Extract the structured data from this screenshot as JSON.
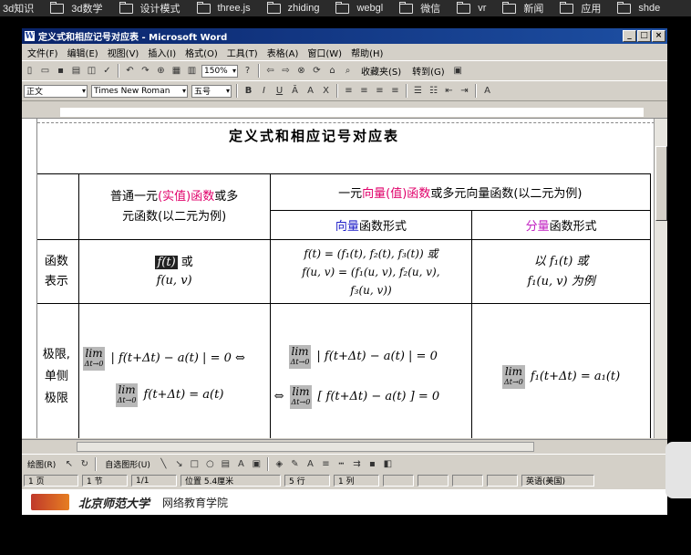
{
  "bookmarks": [
    "3d知识",
    "3d数学",
    "设计模式",
    "three.js",
    "zhiding",
    "webgl",
    "微信",
    "vr",
    "新闻",
    "应用",
    "shde"
  ],
  "window": {
    "title": "定义式和相应记号对应表 - Microsoft Word",
    "icon_letter": "W"
  },
  "menus": [
    "文件(F)",
    "编辑(E)",
    "视图(V)",
    "插入(I)",
    "格式(O)",
    "工具(T)",
    "表格(A)",
    "窗口(W)",
    "帮助(H)"
  ],
  "toolbar": {
    "zoom": "150%",
    "favorites": "收藏夹(S)",
    "goto": "转到(G)",
    "style": "正文",
    "font": "Times New Roman",
    "size": "五号"
  },
  "document": {
    "title": "定义式和相应记号对应表",
    "table": {
      "col1_header": "普通一元(实值)函数或多元函数(以二元为例)",
      "col1_header_a": "普通一元",
      "col1_header_red": "(实值)函数",
      "col1_header_b": "或多",
      "col1_header_c": "元函数(以二元为例)",
      "col23_header_a": "一元",
      "col23_header_red": "向量(值)函数",
      "col23_header_b": "或多元向量函数(以二元为例)",
      "col2_sub_blue": "向量",
      "col2_sub_rest": "函数形式",
      "col3_sub_mag": "分量",
      "col3_sub_rest": "函数形式",
      "row1_label": "函数表示",
      "row1_label_a": "函数",
      "row1_label_b": "表示",
      "row1_col1_a": "f(t)",
      "row1_col1_b": "或",
      "row1_col1_c": "f(u, v)",
      "row1_col2_a": "f(t) = (f₁(t), f₂(t), f₃(t))  或",
      "row1_col2_b": "f(u, v) = (f₁(u, v), f₂(u, v),",
      "row1_col2_c": "f₃(u, v))",
      "row1_col3_a": "以 f₁(t)  或",
      "row1_col3_b": "f₁(u, v)  为例",
      "row2_label_a": "极限,",
      "row2_label_b": "单侧",
      "row2_label_c": "极限",
      "lim": "lim",
      "lim_sub": "Δt→0",
      "row2_col1_a": "| f(t+Δt) − a(t) | = 0 ⇔",
      "row2_col1_b": "f(t+Δt) = a(t)",
      "row2_col2_a": "| f(t+Δt) − a(t) | = 0",
      "row2_col2_prefix": "⇔",
      "row2_col2_b": "[ f(t+Δt) − a(t) ] = 0",
      "row2_col3": "f₁(t+Δt) = a₁(t)"
    }
  },
  "drawbar": {
    "draw": "绘图(R)",
    "autoshapes": "自选图形(U)"
  },
  "status": {
    "page": "1 页",
    "section": "1 节",
    "pages": "1/1",
    "position": "位置 5.4厘米",
    "line": "5 行",
    "column": "1 列",
    "lang": "英语(美国)"
  },
  "footer": {
    "school": "北京师范大学",
    "dept": "网络教育学院"
  },
  "colors": {
    "red": "#e0006a",
    "magenta": "#c020c0",
    "blue": "#2020c8"
  }
}
